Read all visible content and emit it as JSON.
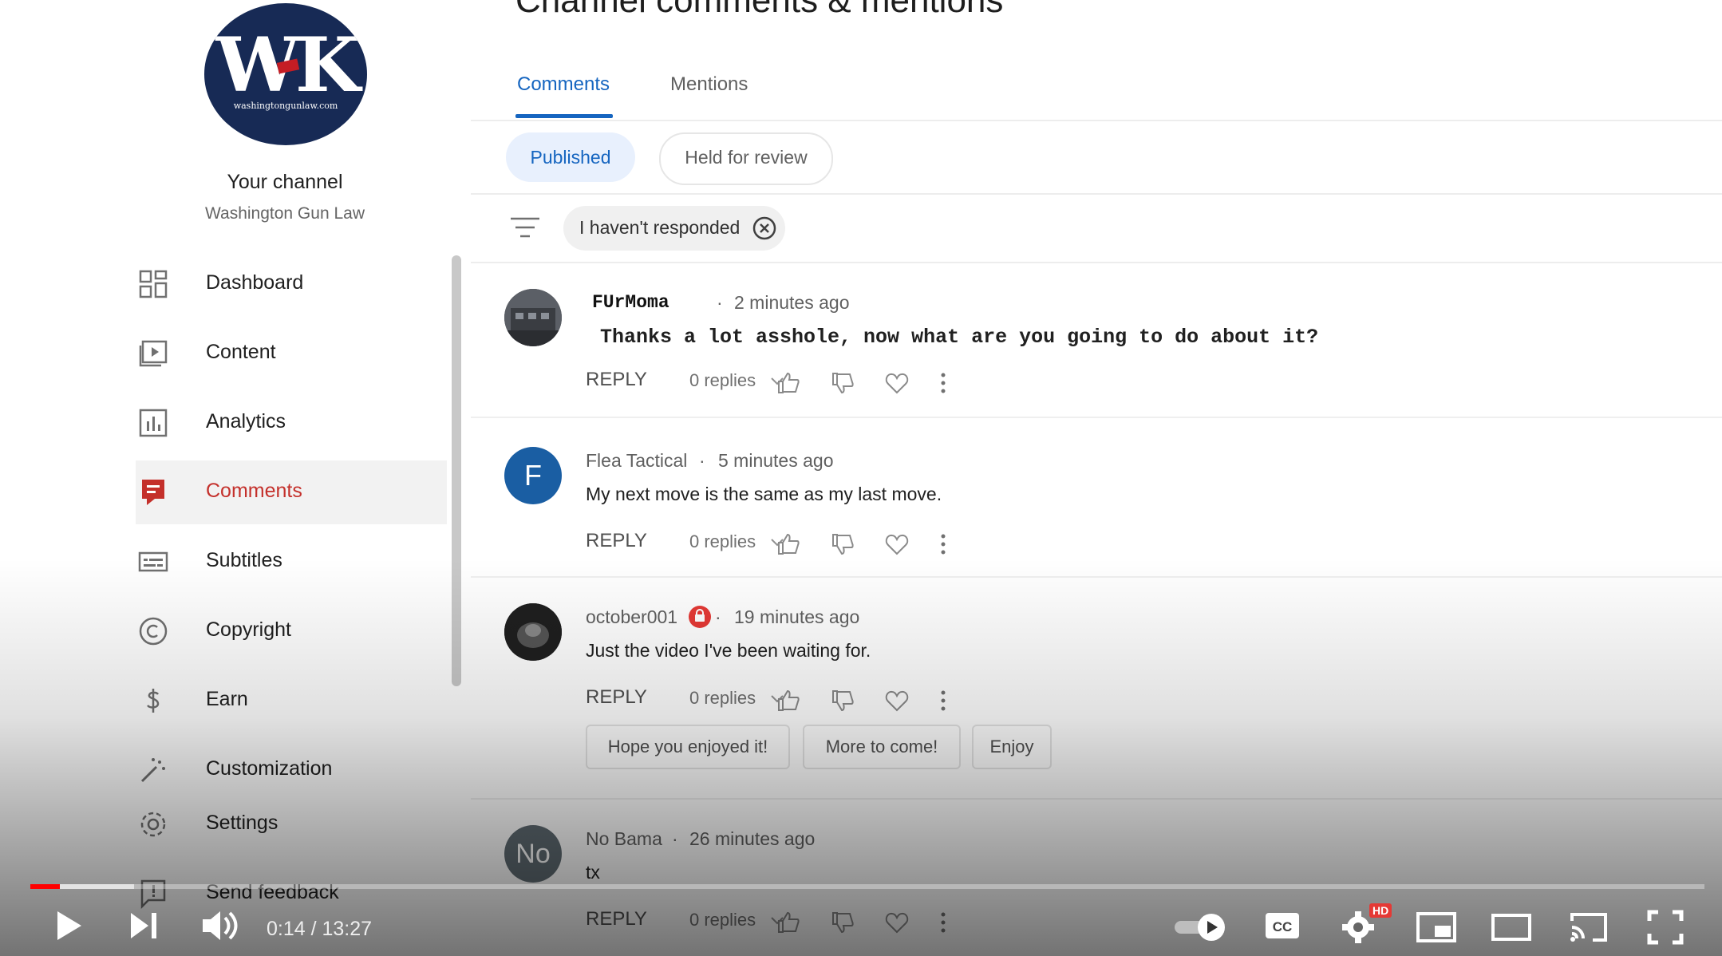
{
  "sidebar": {
    "logo_text": "WK",
    "logo_url": "washingtongunlaw.com",
    "your_channel": "Your channel",
    "channel_name": "Washington Gun Law",
    "items": [
      {
        "label": "Dashboard",
        "icon": "dashboard-icon"
      },
      {
        "label": "Content",
        "icon": "content-icon"
      },
      {
        "label": "Analytics",
        "icon": "analytics-icon"
      },
      {
        "label": "Comments",
        "icon": "comments-icon",
        "active": true
      },
      {
        "label": "Subtitles",
        "icon": "subtitles-icon"
      },
      {
        "label": "Copyright",
        "icon": "copyright-icon"
      },
      {
        "label": "Earn",
        "icon": "earn-icon"
      },
      {
        "label": "Customization",
        "icon": "customization-icon"
      },
      {
        "label": "Settings",
        "icon": "settings-icon"
      },
      {
        "label": "Send feedback",
        "icon": "feedback-icon"
      }
    ]
  },
  "main": {
    "title": "Channel comments & mentions",
    "tabs": [
      {
        "label": "Comments"
      },
      {
        "label": "Mentions"
      }
    ],
    "chips": {
      "published": "Published",
      "held": "Held for review"
    },
    "filter": {
      "label": "I haven't responded"
    },
    "comments": [
      {
        "author": "FUrMoma",
        "time": "2 minutes ago",
        "text": "Thanks a lot asshole, now what are you going to do about it?",
        "reply": "REPLY",
        "replies": "0 replies"
      },
      {
        "author": "Flea Tactical",
        "time": "5 minutes ago",
        "text": "My next move is the same as my last move.",
        "reply": "REPLY",
        "replies": "0 replies",
        "avatar_letter": "F"
      },
      {
        "author": "october001",
        "time": "19 minutes ago",
        "text": "Just the video I've been waiting for.",
        "reply": "REPLY",
        "replies": "0 replies",
        "quick_replies": [
          "Hope you enjoyed it!",
          "More to come!",
          "Enjoy"
        ]
      },
      {
        "author": "No Bama",
        "time": "26 minutes ago",
        "text": "tx",
        "reply": "REPLY",
        "replies": "0 replies",
        "avatar_letter": "No"
      }
    ]
  },
  "player": {
    "time": "0:14 / 13:27",
    "progress_fraction": 0.0174,
    "hd_badge": "HD",
    "colors": {
      "progress": "#ff0000",
      "accent": "#1565c0",
      "active_nav": "#c4302b"
    }
  }
}
